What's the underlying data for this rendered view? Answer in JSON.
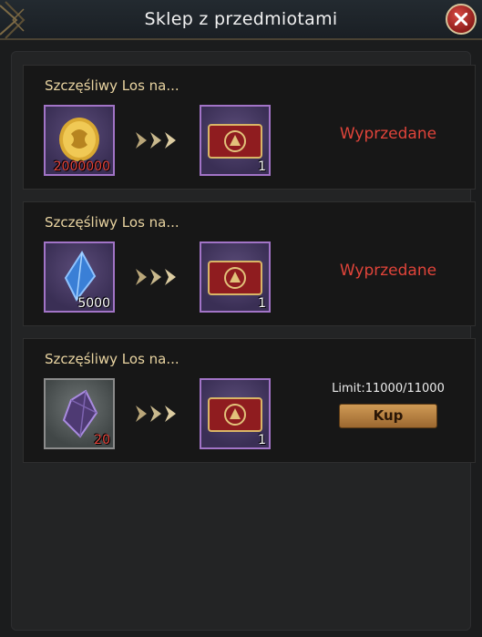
{
  "window": {
    "title": "Sklep z przedmiotami",
    "close_icon": "close-icon"
  },
  "colors": {
    "sold_out": "#e0443a",
    "slot_border_purple": "#a274c7",
    "title_text": "#e9d4a1"
  },
  "offers": [
    {
      "title": "Szczęśliwy Los na...",
      "cost_icon": "gold-coin-icon",
      "cost_qty": "2000000",
      "reward_icon": "lottery-ticket-icon",
      "reward_qty": "1",
      "status": "Wyprzedane"
    },
    {
      "title": "Szczęśliwy Los na...",
      "cost_icon": "blue-crystal-icon",
      "cost_qty": "5000",
      "reward_icon": "lottery-ticket-icon",
      "reward_qty": "1",
      "status": "Wyprzedane"
    },
    {
      "title": "Szczęśliwy Los na...",
      "cost_icon": "dark-crystal-icon",
      "cost_qty": "20",
      "reward_icon": "lottery-ticket-icon",
      "reward_qty": "1",
      "limit": "Limit:11000/11000",
      "buy_label": "Kup"
    }
  ]
}
